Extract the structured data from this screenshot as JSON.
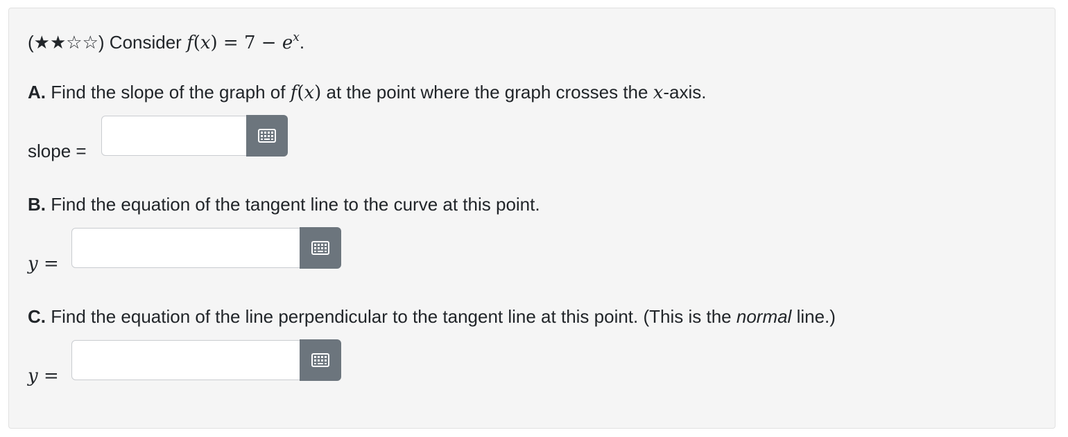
{
  "problem": {
    "intro": {
      "prefix": "(",
      "stars": "★★☆☆",
      "suffix": ") Consider ",
      "fx": "f",
      "open": "(",
      "x": "x",
      "close": ")",
      "rhs": " = 7 − ",
      "e": "e",
      "exp": "x",
      "end": "."
    },
    "part_a": {
      "letter": "A.",
      "text1": " Find the slope of the graph of ",
      "fx": "f",
      "open": "(",
      "x": "x",
      "close": ")",
      "text2": " at the point where the graph crosses the ",
      "axis_var": "x",
      "text3": "-axis.",
      "answer_label": "slope =",
      "answer_value": ""
    },
    "part_b": {
      "letter": "B.",
      "text": " Find the equation of the tangent line to the curve at this point.",
      "answer_var": "y",
      "answer_eq": " =",
      "answer_value": ""
    },
    "part_c": {
      "letter": "C.",
      "text1": " Find the equation of the line perpendicular to the tangent line at this point. (This is the ",
      "emph": "normal",
      "text2": " line.)",
      "answer_var": "y",
      "answer_eq": " =",
      "answer_value": ""
    }
  },
  "icons": {
    "keyboard": "keyboard-grid-icon"
  },
  "colors": {
    "card_bg": "#f5f5f5",
    "button_bg": "#6c757d",
    "text": "#212529"
  }
}
